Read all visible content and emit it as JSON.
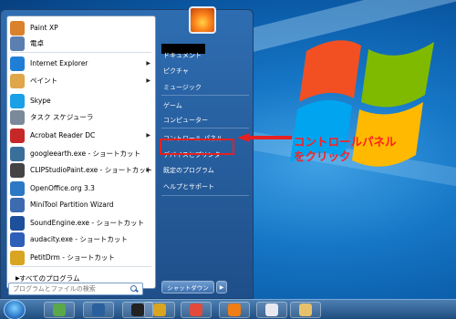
{
  "colors": {
    "accent_red": "#e52020",
    "menu_blue": "#2e6db1"
  },
  "programs": [
    {
      "label": "Paint XP",
      "icon": "paint-icon",
      "color": "#d9822b",
      "has_arrow": false
    },
    {
      "label": "電卓",
      "icon": "calculator-icon",
      "color": "#5a7fb0",
      "has_arrow": false
    },
    {
      "label": "Internet Explorer",
      "icon": "internet-explorer-icon",
      "color": "#1f7fd6",
      "has_arrow": true
    },
    {
      "label": "ペイント",
      "icon": "paint-palette-icon",
      "color": "#e0a64a",
      "has_arrow": true
    },
    {
      "label": "Skype",
      "icon": "skype-icon",
      "color": "#1aa0e6",
      "has_arrow": false
    },
    {
      "label": "タスク スケジューラ",
      "icon": "task-scheduler-icon",
      "color": "#7a8a9a",
      "has_arrow": false
    },
    {
      "label": "Acrobat Reader DC",
      "icon": "acrobat-icon",
      "color": "#c62828",
      "has_arrow": true
    },
    {
      "label": "googleearth.exe - ショートカット",
      "icon": "google-earth-icon",
      "color": "#3a6f9a",
      "has_arrow": false
    },
    {
      "label": "CLIPStudioPaint.exe - ショートカット",
      "icon": "clip-studio-icon",
      "color": "#444444",
      "has_arrow": true
    },
    {
      "label": "OpenOffice.org 3.3",
      "icon": "openoffice-icon",
      "color": "#2c78c4",
      "has_arrow": false
    },
    {
      "label": "MiniTool Partition Wizard",
      "icon": "minitool-icon",
      "color": "#3c6bb0",
      "has_arrow": false
    },
    {
      "label": "SoundEngine.exe - ショートカット",
      "icon": "soundengine-icon",
      "color": "#1d4f9a",
      "has_arrow": false
    },
    {
      "label": "audacity.exe - ショートカット",
      "icon": "audacity-icon",
      "color": "#2d5fb8",
      "has_arrow": false
    },
    {
      "label": "PetitDrm - ショートカット",
      "icon": "petitdrm-icon",
      "color": "#d9a520",
      "has_arrow": false
    }
  ],
  "all_programs": "すべてのプログラム",
  "search_placeholder": "プログラムとファイルの検索",
  "right_items": [
    {
      "label": "ドキュメント"
    },
    {
      "label": "ピクチャ"
    },
    {
      "label": "ミュージック"
    },
    {
      "label": "ゲーム"
    },
    {
      "label": "コンピューター"
    },
    {
      "label": "コントロール パネル"
    },
    {
      "label": "デバイスとプリンター"
    },
    {
      "label": "既定のプログラム"
    },
    {
      "label": "ヘルプとサポート"
    }
  ],
  "shutdown_label": "シャットダウン",
  "annotation": {
    "line1": "コントロールパネル",
    "line2": "をクリック"
  },
  "taskbar_items": [
    {
      "icon": "frog-app-icon",
      "color": "#5aa84a"
    },
    {
      "icon": "virtualbox-icon",
      "color": "#2a5f9e"
    },
    {
      "icon": "terminal-icon",
      "color": "#222222"
    },
    {
      "icon": "hidemaru-editor-icon",
      "color": "#d9a520"
    },
    {
      "icon": "chrome-icon",
      "color": "#e24a3b"
    },
    {
      "icon": "vlc-icon",
      "color": "#f07e14"
    },
    {
      "icon": "itunes-icon",
      "color": "#e8e8f0"
    },
    {
      "icon": "explorer-folder-icon",
      "color": "#e7c16a"
    }
  ]
}
